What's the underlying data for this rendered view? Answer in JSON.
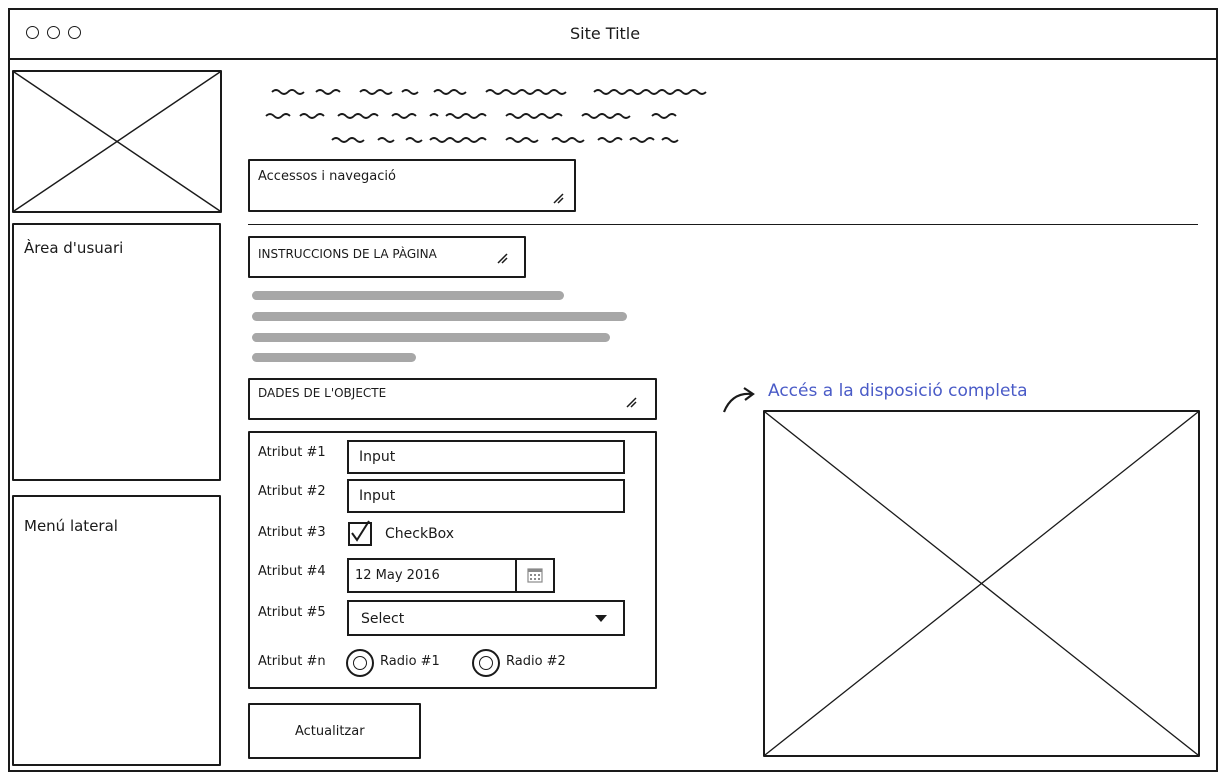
{
  "window": {
    "title": "Site Title",
    "controls": [
      "circle",
      "circle",
      "circle"
    ]
  },
  "sidebar": {
    "logo_placeholder": "image-placeholder",
    "user_area_label": "Àrea d'usuari",
    "side_menu_label": "Menú lateral"
  },
  "header": {
    "squiggle_lines": 3,
    "access_box_label": "Accessos i navegació"
  },
  "main": {
    "instructions_label": "INSTRUCCIONS DE LA PÀGINA",
    "object_data_label": "DADES DE L'OBJECTE",
    "form": {
      "attr1_label": "Atribut #1",
      "attr1_value": "Input",
      "attr2_label": "Atribut #2",
      "attr2_value": "Input",
      "attr3_label": "Atribut #3",
      "attr3_checkbox_label": "CheckBox",
      "attr3_checked": true,
      "attr4_label": "Atribut #4",
      "attr4_value": "12 May 2016",
      "attr5_label": "Atribut #5",
      "attr5_value": "Select",
      "attrn_label": "Atribut #n",
      "radio1_label": "Radio #1",
      "radio2_label": "Radio #2"
    },
    "update_button": "Actualitzar"
  },
  "right_panel": {
    "link_label": "Accés a la disposició completa",
    "link_color": "#4a5bc7"
  },
  "icons": {
    "calendar": "calendar-icon",
    "dropdown": "chevron-down-icon",
    "arrow": "curved-arrow-icon",
    "resize": "resize-grip-icon"
  }
}
